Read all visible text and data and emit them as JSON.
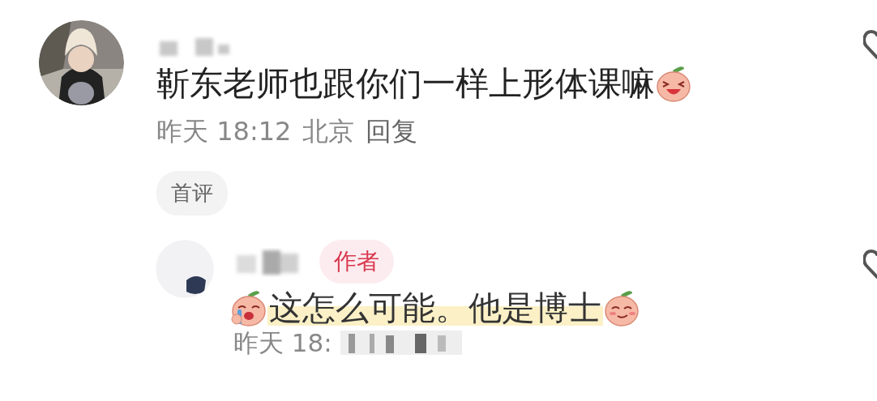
{
  "comment": {
    "text": "靳东老师也跟你们一样上形体课嘛",
    "time": "昨天 18:12",
    "location": "北京",
    "reply_link": "回复",
    "tag": "首评",
    "liked": false
  },
  "reply": {
    "badge": "作者",
    "text": "这怎么可能。他是博士",
    "highlighted": true,
    "time": "昨天 18:",
    "liked": false
  }
}
